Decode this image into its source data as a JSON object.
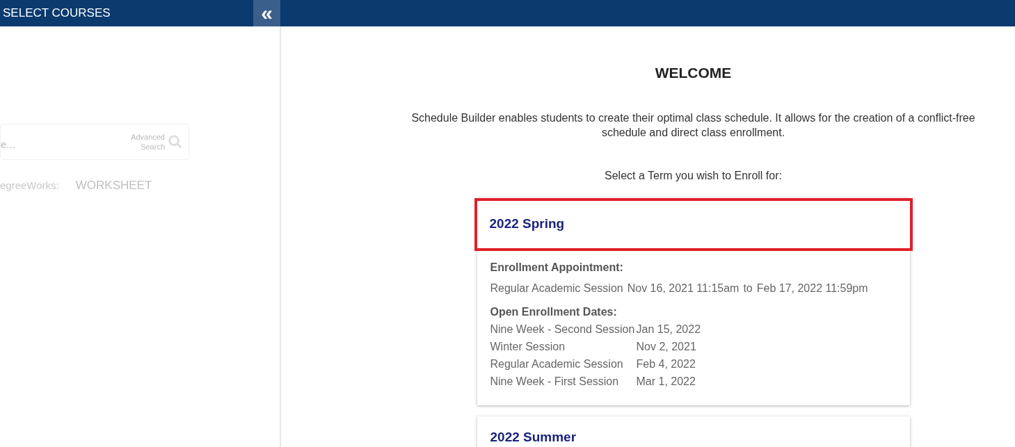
{
  "sidebar": {
    "title": "SELECT COURSES",
    "collapse_icon": "«",
    "search": {
      "placeholder": "e...",
      "advanced": "Advanced Search"
    },
    "degreeworks_label": "egreeWorks:",
    "worksheet": "WORKSHEET"
  },
  "main": {
    "heading": "WELCOME",
    "intro": "Schedule Builder enables students to create their optimal class schedule. It allows for the creation of a conflict-free schedule and direct class enrollment.",
    "prompt": "Select a Term you wish to Enroll for:",
    "terms": [
      {
        "name": "2022 Spring",
        "highlighted": true,
        "expanded": true,
        "appointment_label": "Enrollment Appointment:",
        "appointment": {
          "session": "Regular Academic Session",
          "start": "Nov 16, 2021 11:15am",
          "to": "to",
          "end": "Feb 17, 2022 11:59pm"
        },
        "open_label": "Open Enrollment Dates:",
        "open_dates": [
          {
            "session": "Nine Week - Second Session",
            "date": "Jan 15, 2022"
          },
          {
            "session": "Winter Session",
            "date": "Nov 2, 2021"
          },
          {
            "session": "Regular Academic Session",
            "date": "Feb 4, 2022"
          },
          {
            "session": "Nine Week - First Session",
            "date": "Mar 1, 2022"
          }
        ]
      },
      {
        "name": "2022 Summer",
        "highlighted": false,
        "expanded": false
      }
    ]
  }
}
